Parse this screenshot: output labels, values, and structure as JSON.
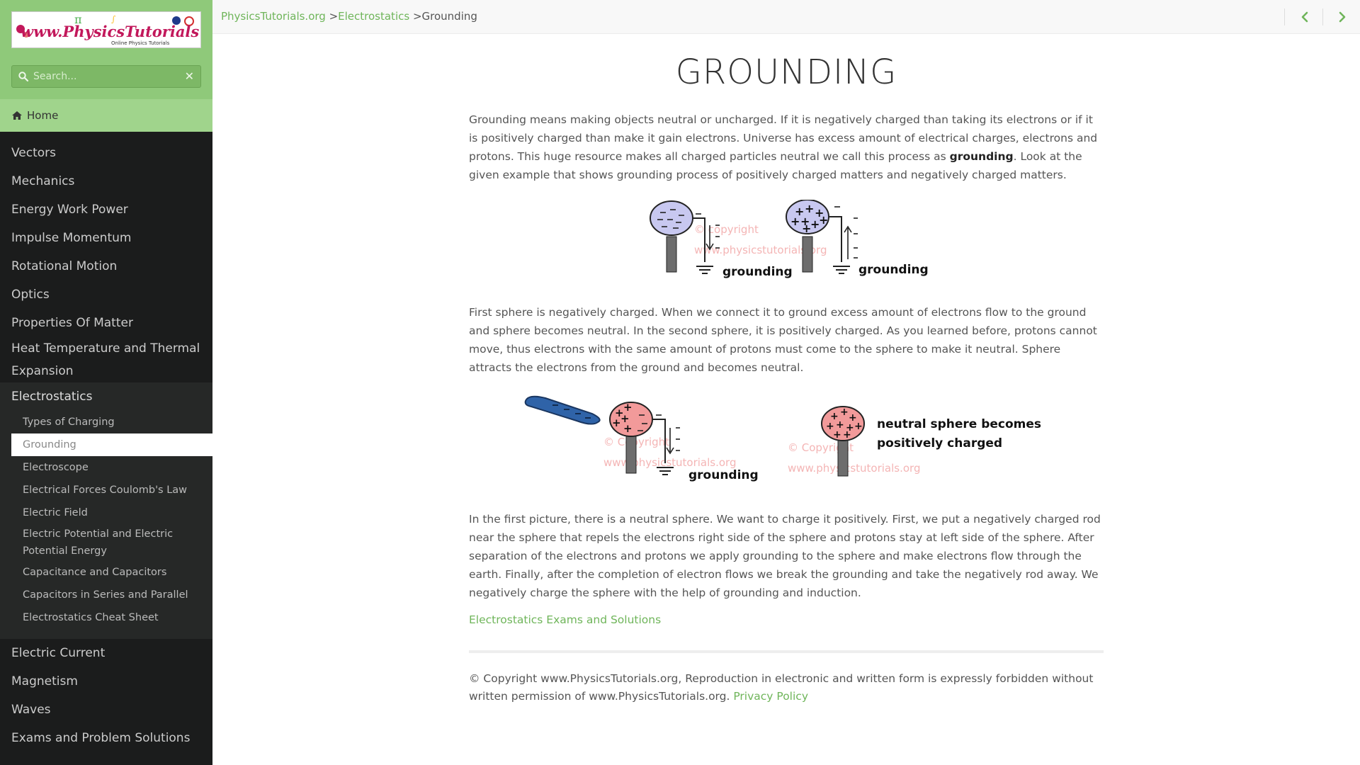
{
  "site": {
    "logo_text": "www.PhysicsTutorials.org",
    "logo_tagline": "Online Physics Tutorials"
  },
  "search": {
    "placeholder": "Search...",
    "clear_glyph": "✕"
  },
  "sidebar": {
    "home_label": "Home",
    "items": [
      {
        "label": "Vectors"
      },
      {
        "label": "Mechanics"
      },
      {
        "label": "Energy Work Power"
      },
      {
        "label": "Impulse Momentum"
      },
      {
        "label": "Rotational Motion"
      },
      {
        "label": "Optics"
      },
      {
        "label": "Properties Of Matter"
      },
      {
        "label": "Heat Temperature and Thermal Expansion"
      }
    ],
    "group": {
      "label": "Electrostatics",
      "children": [
        {
          "label": "Types of Charging"
        },
        {
          "label": "Grounding"
        },
        {
          "label": "Electroscope"
        },
        {
          "label": "Electrical Forces Coulomb's Law"
        },
        {
          "label": "Electric Field"
        },
        {
          "label": "Electric Potential and Electric Potential Energy"
        },
        {
          "label": "Capacitance and Capacitors"
        },
        {
          "label": "Capacitors in Series and Parallel"
        },
        {
          "label": "Electrostatics Cheat Sheet"
        }
      ]
    },
    "items_after": [
      {
        "label": "Electric Current"
      },
      {
        "label": "Magnetism"
      },
      {
        "label": "Waves"
      },
      {
        "label": "Exams and Problem Solutions"
      }
    ]
  },
  "breadcrumb": {
    "root": "PhysicsTutorials.org",
    "sep1": " >",
    "section": "Electrostatics",
    "sep2": " >",
    "current": "Grounding"
  },
  "page": {
    "title": "GROUNDING",
    "p1_before": "Grounding means making objects neutral or uncharged. If it is negatively charged than taking its electrons or if it is positively charged than make it gain electrons. Universe has excess amount of electrical charges, electrons and protons. This huge resource makes all charged particles neutral we call this process as ",
    "p1_bold": "grounding",
    "p1_after": ". Look at the given example that shows grounding process of positively charged matters and negatively charged matters.",
    "fig1": {
      "label_a": "grounding",
      "label_b": "grounding",
      "watermark1": "© copyright",
      "watermark2": "www.physicstutorials.org"
    },
    "p2": "First sphere is negatively charged. When we connect it to ground excess amount of electrons flow to the ground and sphere becomes neutral. In the second sphere, it is positively charged. As you learned before, protons cannot move, thus electrons with the same amount of protons must come to the sphere to make it neutral. Sphere attracts the electrons from the ground and becomes neutral.",
    "fig2": {
      "label_grounding": "grounding",
      "label_neutral_1": "neutral sphere becomes",
      "label_neutral_2": "positively charged",
      "watermark1": "© Copyright",
      "watermark2": "www.physicstutorials.org"
    },
    "p3": "In the first picture, there is a neutral sphere. We want to charge it positively. First, we put a negatively charged rod near the sphere that repels the electrons right side of the sphere and protons stay at left side of the sphere. After separation of the electrons and protons we apply grounding to the sphere and make electrons flow through the earth. Finally, after the completion of electron flows we break the grounding and take the negatively rod away. We negatively charge the sphere with the help of grounding and induction.",
    "exam_link": "Electrostatics Exams and Solutions",
    "copyright_text": "© Copyright www.PhysicsTutorials.org, Reproduction in electronic and written form is expressly forbidden without written permission of www.PhysicsTutorials.org. ",
    "privacy_link": "Privacy Policy"
  },
  "colors": {
    "accent_green": "#6fb55a",
    "sidebar_dark": "#1b1c1c",
    "sidebar_header": "#8fc97a",
    "neg_sphere": "#c8c8f0",
    "pos_sphere": "#f29a9a",
    "rod_blue": "#2f63a8"
  }
}
